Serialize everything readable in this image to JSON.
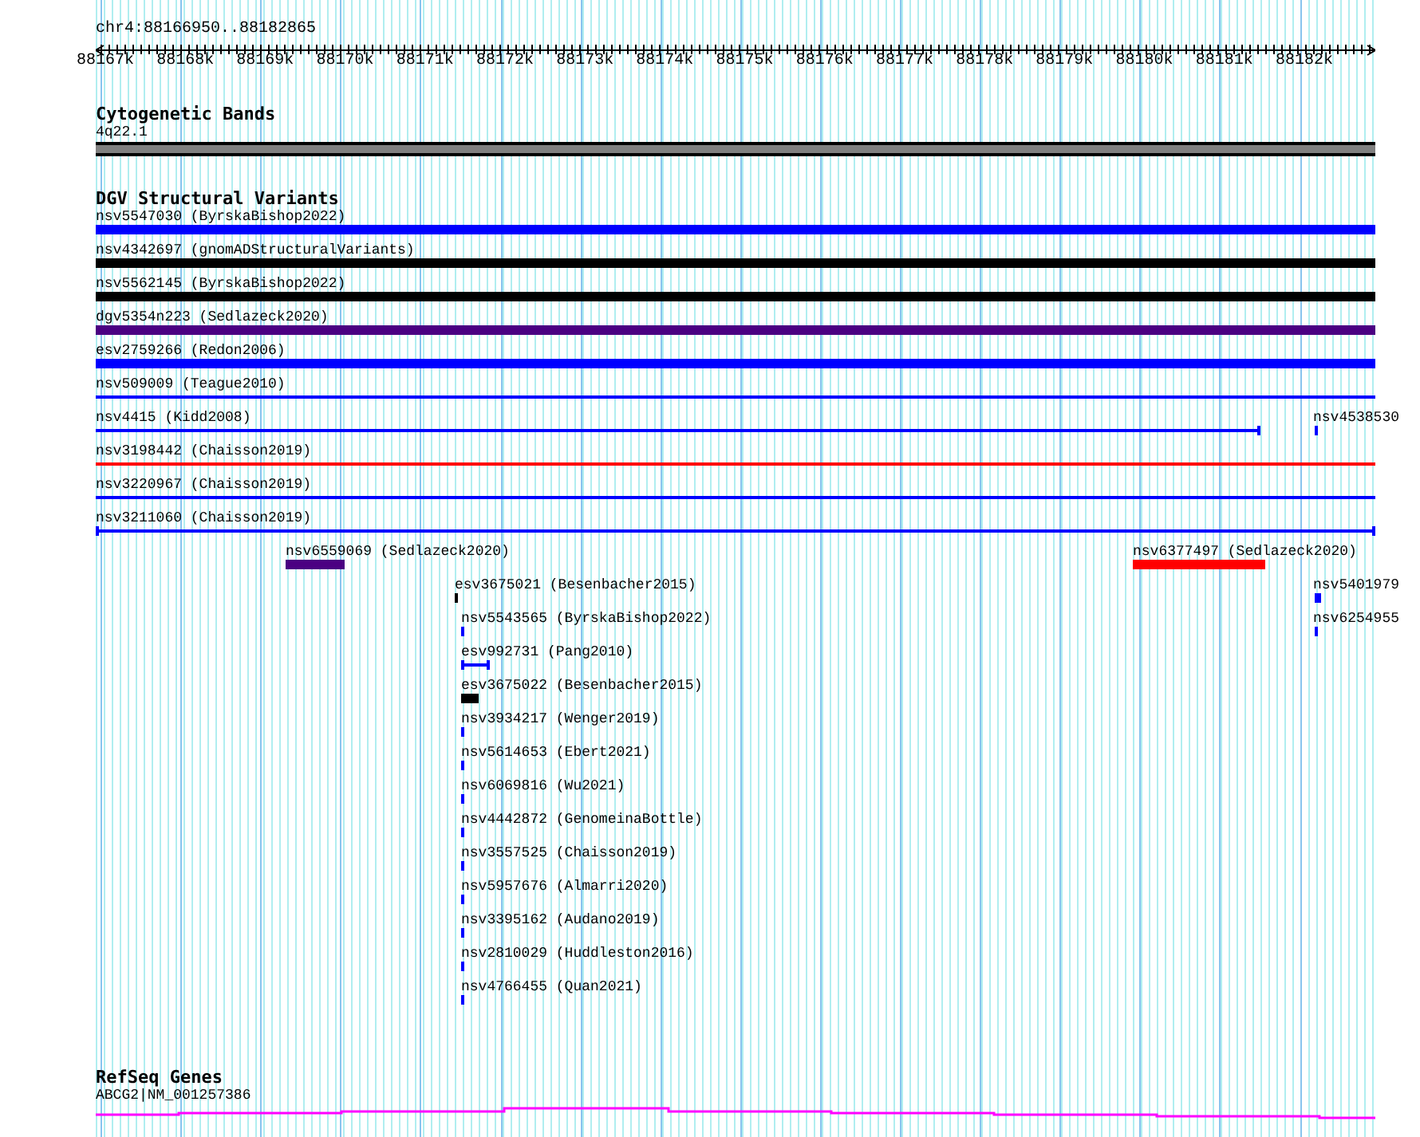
{
  "location": "chr4:88166950..88182865",
  "ruler": {
    "ticks": [
      "88167k",
      "88168k",
      "88169k",
      "88170k",
      "88171k",
      "88172k",
      "88173k",
      "88174k",
      "88175k",
      "88176k",
      "88177k",
      "88178k",
      "88179k",
      "88180k",
      "88181k",
      "88182k"
    ]
  },
  "tracks": [
    {
      "title": "Cytogenetic Bands",
      "features": [
        {
          "label": "4q22.1",
          "kind": "band",
          "color": "#808080"
        }
      ]
    },
    {
      "title": "DGV Structural Variants",
      "features": [
        {
          "label": "nsv5547030 (ByrskaBishop2022)",
          "kind": "bar",
          "color": "#0000ff"
        },
        {
          "label": "nsv4342697 (gnomADStructuralVariants)",
          "kind": "bar",
          "color": "#000000"
        },
        {
          "label": "nsv5562145 (ByrskaBishop2022)",
          "kind": "bar",
          "color": "#000000"
        },
        {
          "label": "dgv5354n223 (Sedlazeck2020)",
          "kind": "bar",
          "color": "#4b0082"
        },
        {
          "label": "esv2759266 (Redon2006)",
          "kind": "bar",
          "color": "#0000ff"
        },
        {
          "label": "nsv509009 (Teague2010)",
          "kind": "line",
          "color": "#0000ff"
        },
        {
          "label": "nsv4415 (Kidd2008)",
          "kind": "span",
          "color": "#0000ff"
        },
        {
          "label": "nsv4538530",
          "kind": "bar",
          "color": "#0000ff"
        },
        {
          "label": "nsv3198442 (Chaisson2019)",
          "kind": "line",
          "color": "#ff0000"
        },
        {
          "label": "nsv3220967 (Chaisson2019)",
          "kind": "line",
          "color": "#0000ff"
        },
        {
          "label": "nsv3211060 (Chaisson2019)",
          "kind": "span",
          "color": "#0000ff"
        },
        {
          "label": "nsv6559069 (Sedlazeck2020)",
          "kind": "bar",
          "color": "#4b0082"
        },
        {
          "label": "nsv6377497 (Sedlazeck2020)",
          "kind": "bar",
          "color": "#ff0000"
        },
        {
          "label": "esv3675021 (Besenbacher2015)",
          "kind": "bar",
          "color": "#000000"
        },
        {
          "label": "nsv5401979",
          "kind": "bar",
          "color": "#0000ff"
        },
        {
          "label": "nsv5543565 (ByrskaBishop2022)",
          "kind": "bar",
          "color": "#0000ff"
        },
        {
          "label": "nsv6254955",
          "kind": "bar",
          "color": "#0000ff"
        },
        {
          "label": "esv992731 (Pang2010)",
          "kind": "span",
          "color": "#0000ff"
        },
        {
          "label": "esv3675022 (Besenbacher2015)",
          "kind": "bar",
          "color": "#000000"
        },
        {
          "label": "nsv3934217 (Wenger2019)",
          "kind": "bar",
          "color": "#0000ff"
        },
        {
          "label": "nsv5614653 (Ebert2021)",
          "kind": "bar",
          "color": "#0000ff"
        },
        {
          "label": "nsv6069816 (Wu2021)",
          "kind": "bar",
          "color": "#0000ff"
        },
        {
          "label": "nsv4442872 (GenomeinaBottle)",
          "kind": "bar",
          "color": "#0000ff"
        },
        {
          "label": "nsv3557525 (Chaisson2019)",
          "kind": "bar",
          "color": "#0000ff"
        },
        {
          "label": "nsv5957676 (Almarri2020)",
          "kind": "bar",
          "color": "#0000ff"
        },
        {
          "label": "nsv3395162 (Audano2019)",
          "kind": "bar",
          "color": "#0000ff"
        },
        {
          "label": "nsv2810029 (Huddleston2016)",
          "kind": "bar",
          "color": "#0000ff"
        },
        {
          "label": "nsv4766455 (Quan2021)",
          "kind": "bar",
          "color": "#0000ff"
        }
      ]
    },
    {
      "title": "RefSeq Genes",
      "features": [
        {
          "label": "ABCG2|NM_001257386",
          "kind": "gene",
          "color": "#ff00ff"
        }
      ]
    }
  ]
}
